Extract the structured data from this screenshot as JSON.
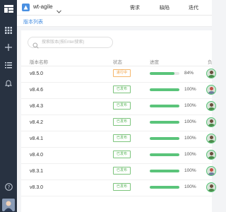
{
  "header": {
    "project_name": "wt-agile",
    "tabs": [
      "需求",
      "缺陷",
      "迭代"
    ]
  },
  "breadcrumb": "版本列表",
  "search": {
    "placeholder": "搜索版本(按Enter搜索)"
  },
  "table": {
    "columns": [
      "版本名称",
      "状态",
      "进度",
      "负"
    ],
    "rows": [
      {
        "name": "v8.5.0",
        "status": "进行中",
        "progress": 84,
        "pct_label": "84%",
        "status_kind": "in-progress"
      },
      {
        "name": "v8.4.6",
        "status": "已发布",
        "progress": 100,
        "pct_label": "100%",
        "status_kind": "released"
      },
      {
        "name": "v8.4.3",
        "status": "已发布",
        "progress": 100,
        "pct_label": "100%",
        "status_kind": "released"
      },
      {
        "name": "v8.4.2",
        "status": "已发布",
        "progress": 100,
        "pct_label": "100%",
        "status_kind": "released"
      },
      {
        "name": "v8.4.1",
        "status": "已发布",
        "progress": 100,
        "pct_label": "100%",
        "status_kind": "released"
      },
      {
        "name": "v8.4.0",
        "status": "已发布",
        "progress": 100,
        "pct_label": "100%",
        "status_kind": "released"
      },
      {
        "name": "v8.3.1",
        "status": "已发布",
        "progress": 100,
        "pct_label": "100%",
        "status_kind": "released"
      },
      {
        "name": "v8.3.0",
        "status": "已发布",
        "progress": 100,
        "pct_label": "100%",
        "status_kind": "released"
      }
    ]
  },
  "colors": {
    "rail": "#283241",
    "accent": "#4a90e2",
    "released": "#56b356",
    "in_progress": "#f09a35",
    "progress_fill": "#5ac47a"
  }
}
